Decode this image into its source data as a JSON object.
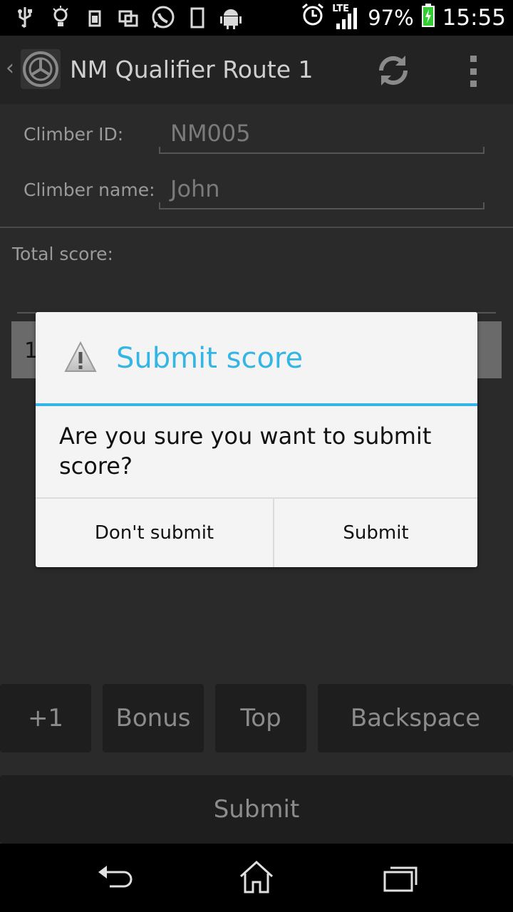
{
  "status_bar": {
    "icons": [
      "usb-icon",
      "lightbulb-icon",
      "device-icon",
      "screens-icon",
      "whatsapp-icon",
      "phone-icon",
      "android-icon",
      "alarm-icon",
      "lte-signal-icon",
      "battery-icon"
    ],
    "network": "LTE",
    "battery_percent": "97%",
    "time": "15:55"
  },
  "action_bar": {
    "title": "NM Qualifier Route 1",
    "icons": [
      "back-chevron-icon",
      "app-logo-icon",
      "refresh-icon",
      "overflow-menu-icon"
    ]
  },
  "form": {
    "climber_id_label": "Climber ID:",
    "climber_id_value": "NM005",
    "climber_name_label": "Climber name:",
    "climber_name_value": "John",
    "total_score_label": "Total score:",
    "score_row_partial": "1"
  },
  "keypad": {
    "plus_one": "+1",
    "bonus": "Bonus",
    "top": "Top",
    "backspace": "Backspace",
    "submit": "Submit"
  },
  "dialog": {
    "title": "Submit score",
    "message": "Are you sure you want to submit score?",
    "negative_button": "Don't submit",
    "positive_button": "Submit",
    "accent_color": "#33b5e5",
    "icon": "warning-icon"
  },
  "nav_bar": {
    "icons": [
      "back-icon",
      "home-icon",
      "recent-apps-icon"
    ]
  }
}
